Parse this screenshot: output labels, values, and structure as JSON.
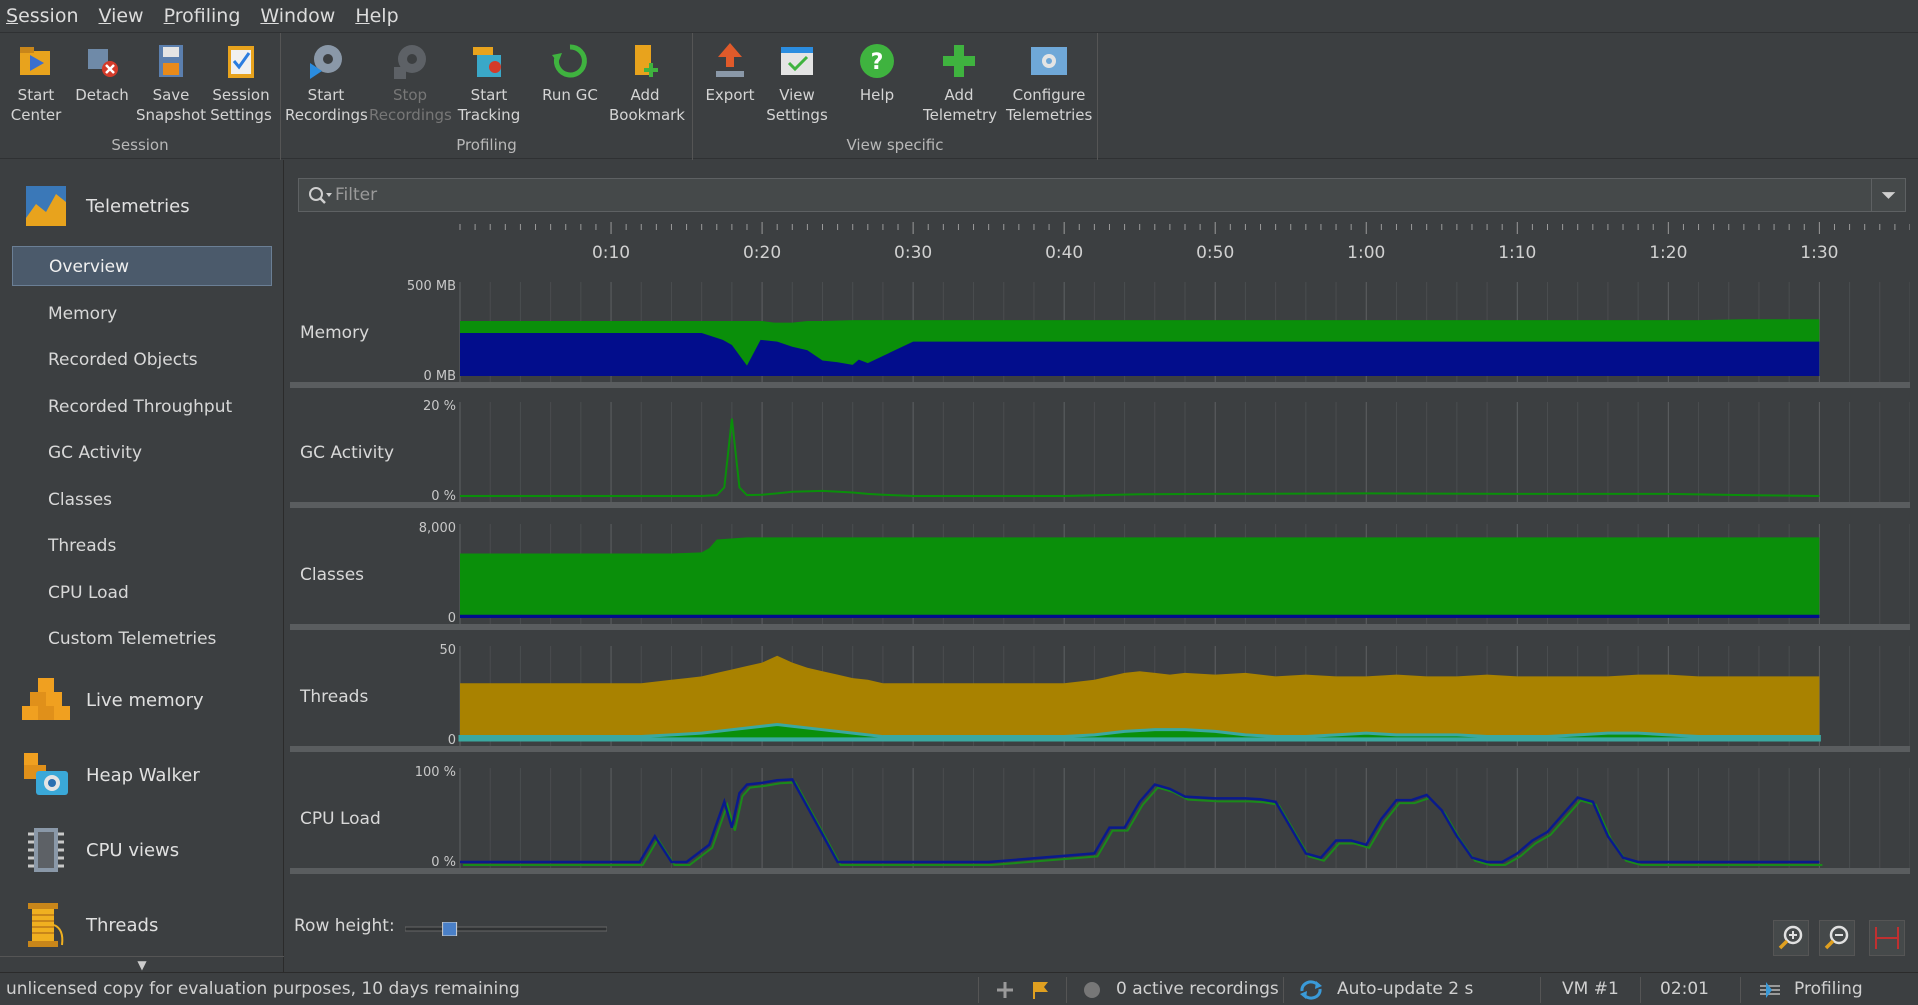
{
  "menu": [
    "Session",
    "View",
    "Profiling",
    "Window",
    "Help"
  ],
  "toolbar": {
    "groups": [
      {
        "title": "Session",
        "buttons": [
          {
            "label": "Start\nCenter",
            "icon": "start-center-icon"
          },
          {
            "label": "Detach",
            "icon": "detach-icon"
          },
          {
            "label": "Save\nSnapshot",
            "icon": "save-snapshot-icon"
          },
          {
            "label": "Session\nSettings",
            "icon": "session-settings-icon"
          }
        ]
      },
      {
        "title": "Profiling",
        "buttons": [
          {
            "label": "Start\nRecordings",
            "icon": "start-recordings-icon"
          },
          {
            "label": "Stop\nRecordings",
            "icon": "stop-recordings-icon",
            "disabled": true
          },
          {
            "label": "Start\nTracking",
            "icon": "start-tracking-icon"
          },
          {
            "label": "Run GC",
            "icon": "run-gc-icon"
          },
          {
            "label": "Add\nBookmark",
            "icon": "add-bookmark-icon"
          }
        ]
      },
      {
        "title": "View specific",
        "buttons": [
          {
            "label": "Export",
            "icon": "export-icon"
          },
          {
            "label": "View\nSettings",
            "icon": "view-settings-icon"
          },
          {
            "label": "Help",
            "icon": "help-icon"
          },
          {
            "label": "Add\nTelemetry",
            "icon": "add-telemetry-icon"
          },
          {
            "label": "Configure\nTelemetries",
            "icon": "configure-telemetries-icon"
          }
        ]
      }
    ]
  },
  "sidebar": {
    "telemetries": "Telemetries",
    "items": [
      "Overview",
      "Memory",
      "Recorded Objects",
      "Recorded Throughput",
      "GC Activity",
      "Classes",
      "Threads",
      "CPU Load",
      "Custom Telemetries"
    ],
    "selected": "Overview",
    "sections": [
      "Live memory",
      "Heap Walker",
      "CPU views",
      "Threads"
    ]
  },
  "filter": {
    "placeholder": "Filter"
  },
  "row_height_label": "Row height:",
  "row_height_value": 0.2,
  "status": {
    "license": "unlicensed copy for evaluation purposes, 10 days remaining",
    "recordings": "0 active recordings",
    "autoupdate": "Auto-update 2 s",
    "vm": "VM #1",
    "time": "02:01",
    "mode": "Profiling"
  },
  "colors": {
    "green": "#0a8f0a",
    "blue": "#020d8c",
    "gold": "#a98200",
    "teal": "#3aa8a0",
    "cpu_line": "#0a1a8c",
    "cpu_line2": "#1a8a1a"
  },
  "chart_data": [
    {
      "type": "area",
      "title": "Memory",
      "ytop_label": "500 MB",
      "ybottom_label": "0 MB",
      "ylim": [
        0,
        500
      ],
      "series": [
        {
          "x": [
            0,
            10,
            20,
            20.8,
            22,
            23,
            24,
            26,
            28,
            29,
            30,
            40,
            46,
            47.5,
            49,
            50,
            51,
            52,
            53,
            54,
            55,
            56,
            57,
            58,
            59,
            60,
            61,
            62,
            63,
            64,
            65,
            67,
            68,
            69,
            70,
            71,
            72,
            73,
            75,
            76,
            77,
            78,
            80,
            80.8,
            82,
            85,
            89,
            89.5,
            90
          ],
          "values": [
            320,
            320,
            320,
            310,
            310,
            320,
            320,
            325,
            325,
            325,
            325,
            325,
            325,
            325,
            325,
            325,
            325,
            325,
            325,
            325,
            325,
            325,
            325,
            325,
            325,
            325,
            325,
            325,
            325,
            325,
            325,
            325,
            325,
            325,
            325,
            325,
            325,
            325,
            325,
            325,
            325,
            325,
            325,
            325,
            325,
            330,
            330,
            330,
            330
          ]
        },
        {
          "x": [
            0,
            10,
            16,
            17.4,
            18,
            19,
            19.9,
            21,
            22,
            23,
            24,
            25,
            26,
            26.4,
            27,
            30,
            40,
            45,
            46,
            47,
            48,
            49,
            50,
            51,
            52,
            53,
            54,
            55,
            56,
            57,
            57.5,
            58,
            59,
            60,
            61,
            62,
            63,
            64,
            65,
            66,
            67,
            68,
            68.3,
            69,
            70,
            71,
            72,
            73,
            74,
            75,
            76,
            77,
            78,
            79,
            80,
            81,
            82,
            85,
            87,
            88,
            89,
            90
          ],
          "values": [
            250,
            250,
            250,
            210,
            180,
            60,
            210,
            200,
            170,
            150,
            90,
            80,
            65,
            95,
            75,
            200,
            200,
            200,
            200,
            200,
            200,
            200,
            200,
            200,
            200,
            200,
            200,
            200,
            200,
            200,
            200,
            200,
            200,
            200,
            200,
            200,
            200,
            200,
            200,
            200,
            200,
            200,
            200,
            200,
            200,
            200,
            200,
            200,
            200,
            200,
            200,
            200,
            200,
            200,
            200,
            200,
            200,
            200,
            200,
            200,
            200,
            200
          ]
        }
      ]
    },
    {
      "type": "line",
      "title": "GC Activity",
      "ytop_label": "20 %",
      "ybottom_label": "0 %",
      "ylim": [
        0,
        20
      ],
      "x": [
        0,
        16,
        17,
        17.5,
        18,
        18.5,
        19,
        20,
        21,
        22,
        24,
        26,
        27,
        28,
        30,
        40,
        45,
        50,
        60,
        70,
        80,
        85,
        90
      ],
      "values": [
        0,
        0,
        0.2,
        2,
        18,
        2,
        0.2,
        0.3,
        0.6,
        1,
        1.2,
        0.8,
        0.5,
        0.3,
        0,
        0,
        0.4,
        0.5,
        0.6,
        0.5,
        0.5,
        0.2,
        0
      ]
    },
    {
      "type": "area",
      "title": "Classes",
      "ytop_label": "8,000",
      "ybottom_label": "0",
      "ylim": [
        0,
        8000
      ],
      "series": [
        {
          "x": [
            0,
            14,
            16,
            16.5,
            17,
            19,
            20,
            90
          ],
          "values": [
            6000,
            6000,
            6100,
            6500,
            7300,
            7500,
            7500,
            7500
          ]
        },
        {
          "x": [
            0,
            90
          ],
          "values": [
            300,
            300
          ]
        }
      ]
    },
    {
      "type": "area",
      "title": "Threads",
      "ytop_label": "50",
      "ybottom_label": "0",
      "ylim": [
        0,
        50
      ],
      "series": [
        {
          "x": [
            0,
            12,
            13,
            14,
            15,
            16,
            17,
            18,
            19,
            20,
            21,
            22,
            23,
            24,
            25,
            26,
            27,
            28,
            30,
            35,
            40,
            42,
            44,
            45,
            46,
            47,
            48,
            50,
            52,
            54,
            56,
            58,
            60,
            62,
            64,
            66,
            68,
            70,
            72,
            74,
            76,
            78,
            80,
            82,
            84,
            86,
            88,
            90
          ],
          "values": [
            33,
            33,
            34,
            35,
            36,
            37,
            39,
            41,
            43,
            45,
            49,
            45,
            42,
            40,
            38,
            36,
            35,
            33,
            33,
            33,
            33,
            35,
            39,
            40,
            39,
            38,
            39,
            38,
            39,
            37,
            38,
            37,
            37,
            38,
            37,
            37,
            38,
            37,
            37,
            37,
            37,
            38,
            38,
            37,
            37,
            37,
            37,
            37
          ]
        },
        {
          "x": [
            0,
            12,
            14,
            16,
            18,
            20,
            21,
            22,
            24,
            26,
            28,
            30,
            35,
            40,
            42,
            44,
            46,
            48,
            50,
            52,
            54,
            56,
            58,
            60,
            62,
            64,
            66,
            68,
            70,
            72,
            74,
            76,
            78,
            80,
            82,
            84,
            86,
            88,
            90
          ],
          "values": [
            2,
            2,
            3,
            4,
            6,
            8,
            9,
            8,
            6,
            4,
            2,
            2,
            2,
            2,
            3,
            5,
            6,
            6,
            5,
            3,
            2,
            2,
            3,
            4,
            3,
            3,
            3,
            2,
            2,
            2,
            3,
            4,
            4,
            3,
            2,
            2,
            2,
            2,
            2
          ]
        },
        {
          "x": [
            0,
            90
          ],
          "values": [
            1.5,
            1.5
          ]
        }
      ]
    },
    {
      "type": "line",
      "title": "CPU Load",
      "ytop_label": "100 %",
      "ybottom_label": "0 %",
      "ylim": [
        0,
        100
      ],
      "x": [
        0,
        10,
        10.9,
        11.9,
        12.9,
        14,
        15,
        16.5,
        17.5,
        18,
        18.5,
        19,
        20,
        21,
        22,
        25,
        26,
        27,
        28,
        29,
        30,
        35,
        42,
        43,
        44,
        45,
        46,
        47,
        48,
        49,
        50,
        51,
        52,
        53,
        54,
        55,
        56,
        57,
        58,
        59,
        60,
        61,
        62,
        63,
        64,
        65,
        66,
        67,
        68,
        69,
        70,
        71,
        72,
        73,
        74,
        75,
        76,
        77,
        78,
        79,
        80,
        85,
        90
      ],
      "values": [
        0,
        0,
        0,
        0,
        30,
        0,
        0,
        20,
        70,
        40,
        80,
        90,
        92,
        95,
        96,
        0,
        0,
        0,
        0,
        0,
        0,
        0,
        10,
        40,
        40,
        70,
        90,
        85,
        76,
        75,
        74,
        74,
        74,
        73,
        70,
        40,
        10,
        5,
        25,
        25,
        20,
        50,
        72,
        72,
        78,
        60,
        30,
        5,
        0,
        0,
        10,
        25,
        35,
        55,
        75,
        70,
        30,
        5,
        0,
        0,
        0,
        0,
        0
      ]
    }
  ],
  "time_axis": {
    "labels": [
      "0:10",
      "0:20",
      "0:30",
      "0:40",
      "0:50",
      "1:00",
      "1:10",
      "1:20",
      "1:30"
    ],
    "max_seconds": 96
  }
}
